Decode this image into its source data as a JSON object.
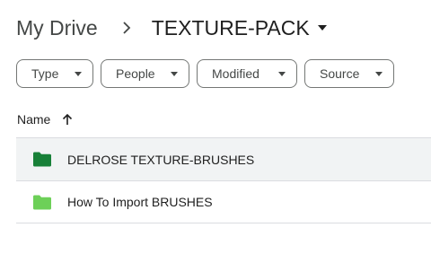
{
  "breadcrumb": {
    "root": "My Drive",
    "separator_icon": "chevron-right-icon",
    "current": "TEXTURE-PACK",
    "current_caret_icon": "caret-down-icon"
  },
  "filters": [
    {
      "label": "Type"
    },
    {
      "label": "People"
    },
    {
      "label": "Modified"
    },
    {
      "label": "Source"
    }
  ],
  "table": {
    "name_header": "Name",
    "sort_icon": "arrow-up-icon",
    "rows": [
      {
        "name": "DELROSE TEXTURE-BRUSHES",
        "icon": "folder-icon",
        "icon_color": "#188038",
        "selected": true
      },
      {
        "name": "How To Import BRUSHES",
        "icon": "folder-icon",
        "icon_color": "#6dd058",
        "selected": false
      }
    ]
  },
  "colors": {
    "row_highlight": "#f1f3f4",
    "divider": "#dadce0",
    "chip_border": "#747775"
  }
}
